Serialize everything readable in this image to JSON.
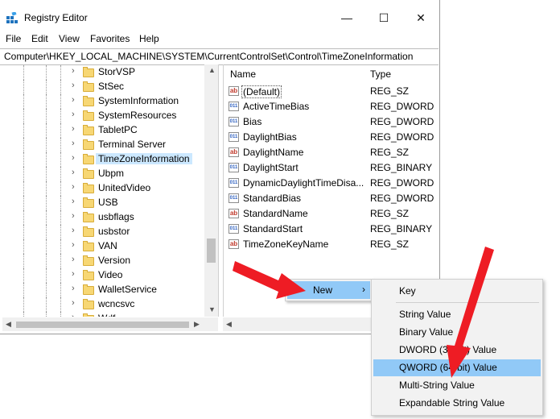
{
  "window": {
    "title": "Registry Editor",
    "controls": {
      "minimize": "—",
      "maximize": "☐",
      "close": "✕"
    }
  },
  "menubar": [
    "File",
    "Edit",
    "View",
    "Favorites",
    "Help"
  ],
  "address": "Computer\\HKEY_LOCAL_MACHINE\\SYSTEM\\CurrentControlSet\\Control\\TimeZoneInformation",
  "tree": {
    "items": [
      {
        "label": "StorVSP"
      },
      {
        "label": "StSec"
      },
      {
        "label": "SystemInformation"
      },
      {
        "label": "SystemResources"
      },
      {
        "label": "TabletPC"
      },
      {
        "label": "Terminal Server"
      },
      {
        "label": "TimeZoneInformation",
        "selected": true
      },
      {
        "label": "Ubpm"
      },
      {
        "label": "UnitedVideo"
      },
      {
        "label": "USB"
      },
      {
        "label": "usbflags"
      },
      {
        "label": "usbstor"
      },
      {
        "label": "VAN"
      },
      {
        "label": "Version"
      },
      {
        "label": "Video"
      },
      {
        "label": "WalletService"
      },
      {
        "label": "wcncsvc"
      },
      {
        "label": "Wdf"
      }
    ]
  },
  "values": {
    "columns": {
      "name": "Name",
      "type": "Type"
    },
    "rows": [
      {
        "name": "(Default)",
        "type": "REG_SZ",
        "icon": "string-value-icon"
      },
      {
        "name": "ActiveTimeBias",
        "type": "REG_DWORD",
        "icon": "binary-value-icon"
      },
      {
        "name": "Bias",
        "type": "REG_DWORD",
        "icon": "binary-value-icon"
      },
      {
        "name": "DaylightBias",
        "type": "REG_DWORD",
        "icon": "binary-value-icon"
      },
      {
        "name": "DaylightName",
        "type": "REG_SZ",
        "icon": "string-value-icon"
      },
      {
        "name": "DaylightStart",
        "type": "REG_BINARY",
        "icon": "binary-value-icon"
      },
      {
        "name": "DynamicDaylightTimeDisa...",
        "type": "REG_DWORD",
        "icon": "binary-value-icon"
      },
      {
        "name": "StandardBias",
        "type": "REG_DWORD",
        "icon": "binary-value-icon"
      },
      {
        "name": "StandardName",
        "type": "REG_SZ",
        "icon": "string-value-icon"
      },
      {
        "name": "StandardStart",
        "type": "REG_BINARY",
        "icon": "binary-value-icon"
      },
      {
        "name": "TimeZoneKeyName",
        "type": "REG_SZ",
        "icon": "string-value-icon"
      }
    ]
  },
  "context_menu": {
    "new_label": "New",
    "submenu": [
      {
        "label": "Key"
      },
      {
        "label": "String Value"
      },
      {
        "label": "Binary Value"
      },
      {
        "label": "DWORD (32-bit) Value"
      },
      {
        "label": "QWORD (64-bit) Value",
        "highlighted": true
      },
      {
        "label": "Multi-String Value"
      },
      {
        "label": "Expandable String Value"
      }
    ]
  },
  "colors": {
    "highlight": "#91c9f7",
    "arrow": "#ee1c24",
    "selection": "#cce8ff"
  }
}
